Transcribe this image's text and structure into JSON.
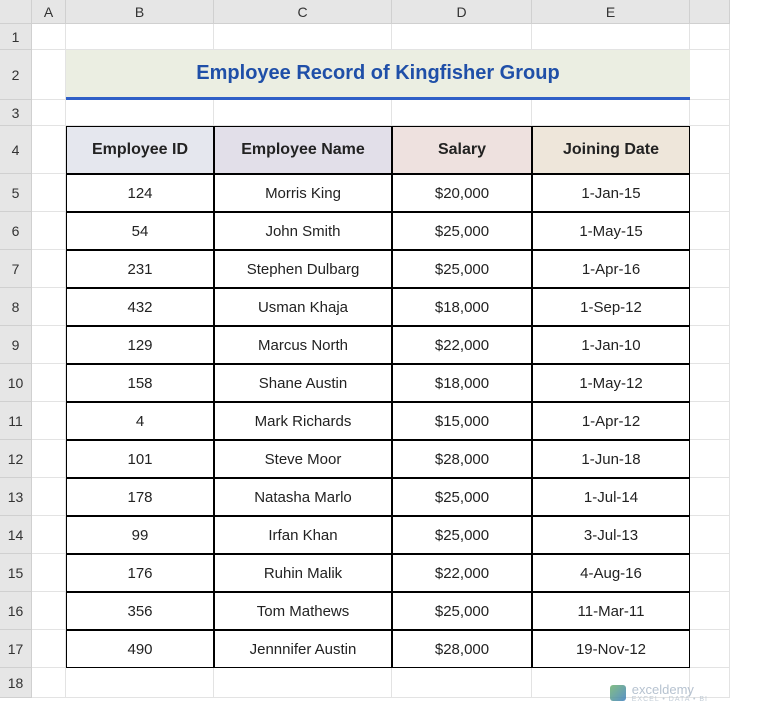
{
  "columns": [
    "A",
    "B",
    "C",
    "D",
    "E"
  ],
  "rows": [
    "1",
    "2",
    "3",
    "4",
    "5",
    "6",
    "7",
    "8",
    "9",
    "10",
    "11",
    "12",
    "13",
    "14",
    "15",
    "16",
    "17",
    "18"
  ],
  "title": "Employee Record of Kingfisher Group",
  "headers": {
    "id": "Employee ID",
    "name": "Employee Name",
    "salary": "Salary",
    "date": "Joining Date"
  },
  "records": [
    {
      "id": "124",
      "name": "Morris King",
      "salary": "$20,000",
      "date": "1-Jan-15"
    },
    {
      "id": "54",
      "name": "John Smith",
      "salary": "$25,000",
      "date": "1-May-15"
    },
    {
      "id": "231",
      "name": "Stephen Dulbarg",
      "salary": "$25,000",
      "date": "1-Apr-16"
    },
    {
      "id": "432",
      "name": "Usman Khaja",
      "salary": "$18,000",
      "date": "1-Sep-12"
    },
    {
      "id": "129",
      "name": "Marcus North",
      "salary": "$22,000",
      "date": "1-Jan-10"
    },
    {
      "id": "158",
      "name": "Shane Austin",
      "salary": "$18,000",
      "date": "1-May-12"
    },
    {
      "id": "4",
      "name": "Mark Richards",
      "salary": "$15,000",
      "date": "1-Apr-12"
    },
    {
      "id": "101",
      "name": "Steve Moor",
      "salary": "$28,000",
      "date": "1-Jun-18"
    },
    {
      "id": "178",
      "name": "Natasha Marlo",
      "salary": "$25,000",
      "date": "1-Jul-14"
    },
    {
      "id": "99",
      "name": "Irfan Khan",
      "salary": "$25,000",
      "date": "3-Jul-13"
    },
    {
      "id": "176",
      "name": "Ruhin Malik",
      "salary": "$22,000",
      "date": "4-Aug-16"
    },
    {
      "id": "356",
      "name": "Tom Mathews",
      "salary": "$25,000",
      "date": "11-Mar-11"
    },
    {
      "id": "490",
      "name": "Jennnifer Austin",
      "salary": "$28,000",
      "date": "19-Nov-12"
    }
  ],
  "watermark": {
    "brand": "exceldemy",
    "tag": "EXCEL • DATA • BI"
  },
  "chart_data": {
    "type": "table",
    "title": "Employee Record of Kingfisher Group",
    "columns": [
      "Employee ID",
      "Employee Name",
      "Salary",
      "Joining Date"
    ],
    "rows": [
      [
        "124",
        "Morris King",
        "$20,000",
        "1-Jan-15"
      ],
      [
        "54",
        "John Smith",
        "$25,000",
        "1-May-15"
      ],
      [
        "231",
        "Stephen Dulbarg",
        "$25,000",
        "1-Apr-16"
      ],
      [
        "432",
        "Usman Khaja",
        "$18,000",
        "1-Sep-12"
      ],
      [
        "129",
        "Marcus North",
        "$22,000",
        "1-Jan-10"
      ],
      [
        "158",
        "Shane Austin",
        "$18,000",
        "1-May-12"
      ],
      [
        "4",
        "Mark Richards",
        "$15,000",
        "1-Apr-12"
      ],
      [
        "101",
        "Steve Moor",
        "$28,000",
        "1-Jun-18"
      ],
      [
        "178",
        "Natasha Marlo",
        "$25,000",
        "1-Jul-14"
      ],
      [
        "99",
        "Irfan Khan",
        "$25,000",
        "3-Jul-13"
      ],
      [
        "176",
        "Ruhin Malik",
        "$22,000",
        "4-Aug-16"
      ],
      [
        "356",
        "Tom Mathews",
        "$25,000",
        "11-Mar-11"
      ],
      [
        "490",
        "Jennnifer Austin",
        "$28,000",
        "19-Nov-12"
      ]
    ]
  }
}
